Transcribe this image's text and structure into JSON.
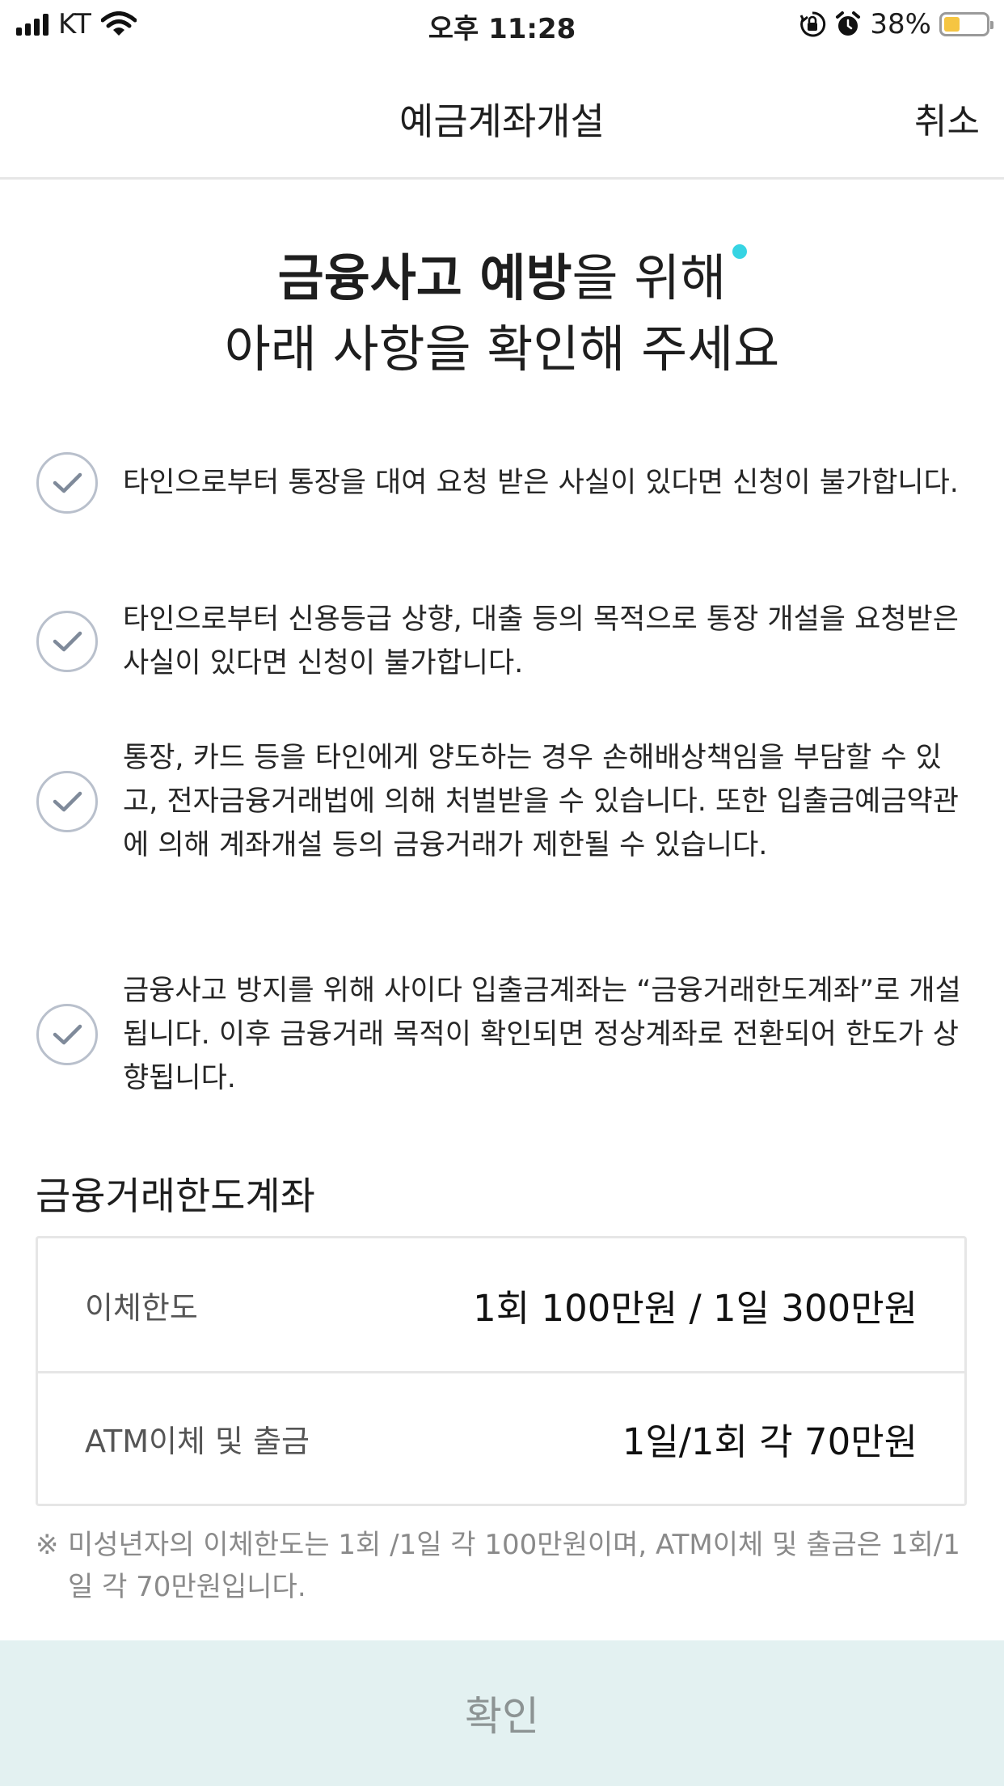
{
  "status_bar": {
    "carrier": "KT",
    "time": "오후 11:28",
    "battery_percent": "38%",
    "battery_level": 0.38,
    "icons": [
      "signal-icon",
      "wifi-icon",
      "orientation-lock-icon",
      "alarm-icon",
      "battery-icon"
    ]
  },
  "nav": {
    "title": "예금계좌개설",
    "cancel_label": "취소"
  },
  "headline": {
    "strong": "금융사고 예방",
    "rest_line1": "을 위해",
    "line2": "아래 사항을 확인해 주세요"
  },
  "checklist": [
    {
      "text": "타인으로부터 통장을 대여 요청 받은 사실이 있다면 신청이 불가합니다."
    },
    {
      "text": "타인으로부터 신용등급 상향, 대출 등의 목적으로 통장 개설을 요청받은 사실이 있다면 신청이 불가합니다."
    },
    {
      "text": "통장, 카드 등을 타인에게 양도하는 경우 손해배상책임을 부담할 수 있고, 전자금융거래법에 의해 처벌받을 수 있습니다. 또한 입출금예금약관에 의해 계좌개설 등의 금융거래가 제한될 수 있습니다."
    },
    {
      "text": "금융사고 방지를 위해 사이다 입출금계좌는 “금융거래한도계좌”로 개설 됩니다. 이후 금융거래 목적이 확인되면 정상계좌로 전환되어 한도가 상향됩니다."
    }
  ],
  "limit_section": {
    "title": "금융거래한도계좌",
    "rows": [
      {
        "label": "이체한도",
        "value": "1회 100만원 / 1일 300만원"
      },
      {
        "label": "ATM이체 및 출금",
        "value": "1일/1회 각 70만원"
      }
    ],
    "note_mark": "※",
    "note": "미성년자의 이체한도는 1회 /1일 각 100만원이며, ATM이체 및 출금은 1회/1일 각 70만원입니다."
  },
  "confirm_label": "확인",
  "colors": {
    "highlight": "#62e3ee",
    "check_circle": "#b9c0cc",
    "check_mark": "#7f8a9a",
    "confirm_bg": "#e3f1f1",
    "confirm_text": "#8c9393",
    "battery": "#f5c542"
  }
}
